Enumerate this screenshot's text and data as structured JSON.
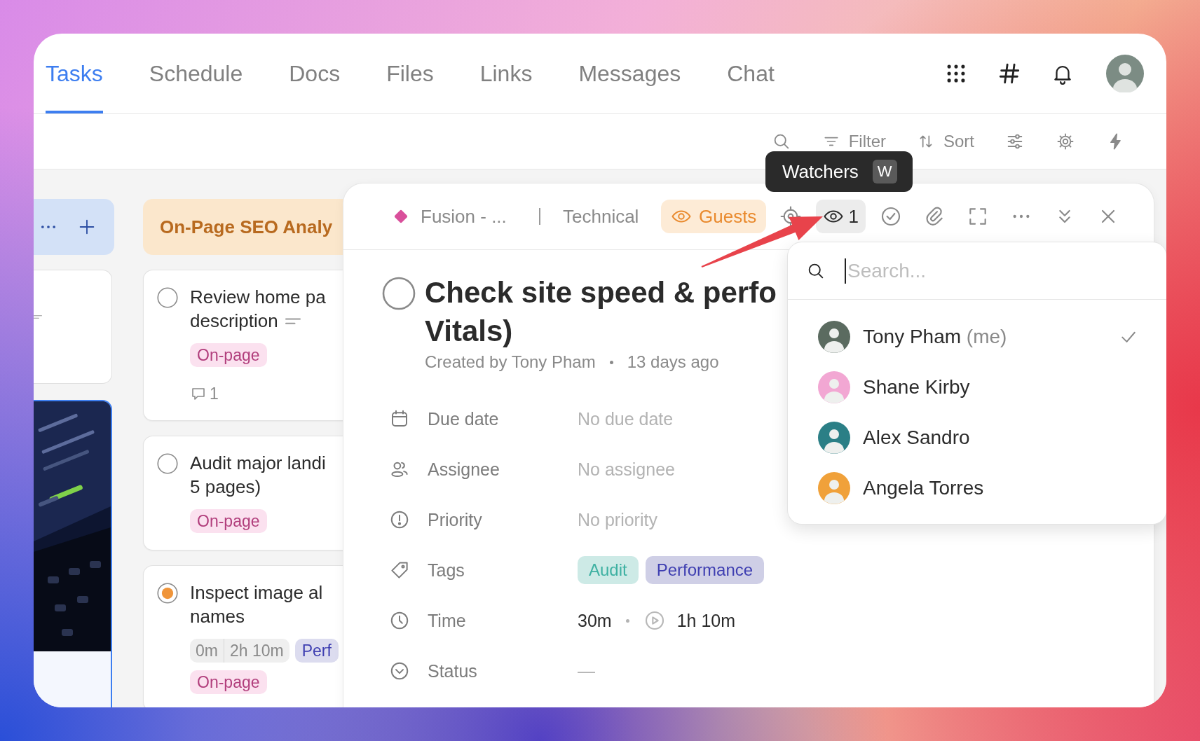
{
  "nav": {
    "tabs": [
      {
        "label": "Tasks",
        "selected": true
      },
      {
        "label": "Schedule",
        "selected": false
      },
      {
        "label": "Docs",
        "selected": false
      },
      {
        "label": "Files",
        "selected": false
      },
      {
        "label": "Links",
        "selected": false
      },
      {
        "label": "Messages",
        "selected": false
      },
      {
        "label": "Chat",
        "selected": false
      }
    ]
  },
  "toolbar": {
    "filter": "Filter",
    "sort": "Sort"
  },
  "tooltip": {
    "label": "Watchers",
    "shortcut": "W"
  },
  "board": {
    "column_1": {
      "cards": [
        {
          "kind": "blank",
          "selected": false
        },
        {
          "kind": "picture",
          "selected": true
        }
      ]
    },
    "column_2": {
      "title": "On-Page SEO Analy",
      "cards": [
        {
          "title_lines": [
            "Review home pa",
            "description"
          ],
          "in_progress": false,
          "has_description": true,
          "tags": [
            {
              "label": "On-page",
              "color": "#fbe1ef"
            }
          ],
          "comments": "1"
        },
        {
          "title_lines": [
            "Audit major landi",
            "5 pages)"
          ],
          "in_progress": false,
          "tags": [
            {
              "label": "On-page",
              "color": "#fbe1ef"
            }
          ]
        },
        {
          "title_lines": [
            "Inspect image al",
            "names"
          ],
          "in_progress": true,
          "time": [
            "0m",
            "2h 10m"
          ],
          "tags": [
            {
              "label": "Perf",
              "color": "#dcdcef"
            },
            {
              "label": "On-page",
              "color": "#fbe1ef"
            }
          ]
        }
      ]
    }
  },
  "panel": {
    "breadcrumb": {
      "space": "Fusion - ...",
      "list": "Technical"
    },
    "guests": "Guests",
    "watchers": {
      "count": "1",
      "active": true
    },
    "task": {
      "in_progress": false,
      "title_lines": [
        "Check site speed & perfo",
        "Vitals)"
      ],
      "created_by": "Created by Tony Pham",
      "created_ago": "13 days ago",
      "fields": [
        {
          "kind": "date",
          "label": "Due date",
          "value": "No due date",
          "empty": true
        },
        {
          "kind": "assignee",
          "label": "Assignee",
          "value": "No assignee",
          "empty": true
        },
        {
          "kind": "priority",
          "label": "Priority",
          "value": "No priority",
          "empty": true
        },
        {
          "kind": "tags",
          "label": "Tags",
          "tags": [
            {
              "label": "Audit",
              "color": "#cdeae6"
            },
            {
              "label": "Performance",
              "color": "#cfcfe6"
            }
          ]
        },
        {
          "kind": "time",
          "label": "Time",
          "estimate": "30m",
          "tracked": "1h 10m"
        },
        {
          "kind": "status",
          "label": "Status",
          "value": "—",
          "empty": true
        }
      ]
    }
  },
  "dropdown": {
    "search": {
      "placeholder": "Search..."
    },
    "people": [
      {
        "name": "Tony Pham",
        "suffix": "(me)",
        "color": "#5b6b60",
        "selected": true
      },
      {
        "name": "Shane Kirby",
        "color": "#f2a7d3",
        "selected": false
      },
      {
        "name": "Alex Sandro",
        "color": "#2b7f86",
        "selected": false
      },
      {
        "name": "Angela Torres",
        "color": "#f0a13a",
        "selected": false
      }
    ]
  }
}
